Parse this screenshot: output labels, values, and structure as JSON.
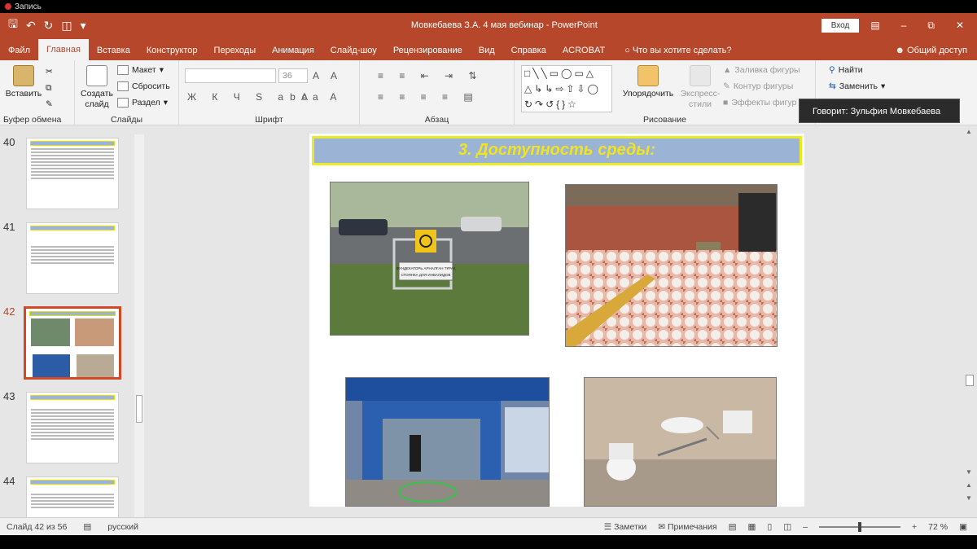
{
  "recording": {
    "label": "Запись"
  },
  "window": {
    "title": "Мовкебаева З.А. 4 мая вебинар  -  PowerPoint",
    "login_label": "Вход"
  },
  "tabs": [
    {
      "label": "Файл"
    },
    {
      "label": "Главная"
    },
    {
      "label": "Вставка"
    },
    {
      "label": "Конструктор"
    },
    {
      "label": "Переходы"
    },
    {
      "label": "Анимация"
    },
    {
      "label": "Слайд-шоу"
    },
    {
      "label": "Рецензирование"
    },
    {
      "label": "Вид"
    },
    {
      "label": "Справка"
    },
    {
      "label": "ACROBAT"
    },
    {
      "label": "Что вы хотите сделать?"
    }
  ],
  "share_label": "Общий доступ",
  "ribbon": {
    "clipboard": {
      "paste": "Вставить",
      "label": "Буфер обмена"
    },
    "slides": {
      "create": "Создать",
      "create2": "слайд",
      "layout": "Макет",
      "reset": "Сбросить",
      "section": "Раздел",
      "label": "Слайды"
    },
    "font": {
      "size": "36",
      "label": "Шрифт",
      "style_glyphs": "Ж К Ч S abc"
    },
    "paragraph": {
      "label": "Абзац"
    },
    "drawing": {
      "arrange": "Упорядочить",
      "express1": "Экспресс-",
      "express2": "стили",
      "fill": "Заливка фигуры",
      "outline": "Контур фигуры",
      "effects": "Эффекты фигур",
      "label": "Рисование"
    },
    "editing": {
      "find": "Найти",
      "replace": "Заменить"
    }
  },
  "tooltip": "Говорит: Зульфия Мовкебаева",
  "thumbnails": [
    {
      "num": "40"
    },
    {
      "num": "41"
    },
    {
      "num": "42"
    },
    {
      "num": "43"
    },
    {
      "num": "44"
    }
  ],
  "slide": {
    "title": "3. Доступность среды:",
    "sign_text": "ФУНДЕКАТОРЬ АРНАЛҒАН ТҰРАҚ СТОЯНКА ДЛЯ ИНВАЛИДОВ"
  },
  "status": {
    "slide_info": "Слайд 42 из 56",
    "language": "русский",
    "notes": "Заметки",
    "comments": "Примечания",
    "zoom": "72 %",
    "zoom_fraction": 0.5
  },
  "colors": {
    "accent": "#b7472a",
    "title_band": "#9bb3d4",
    "title_text": "#f1e322"
  }
}
